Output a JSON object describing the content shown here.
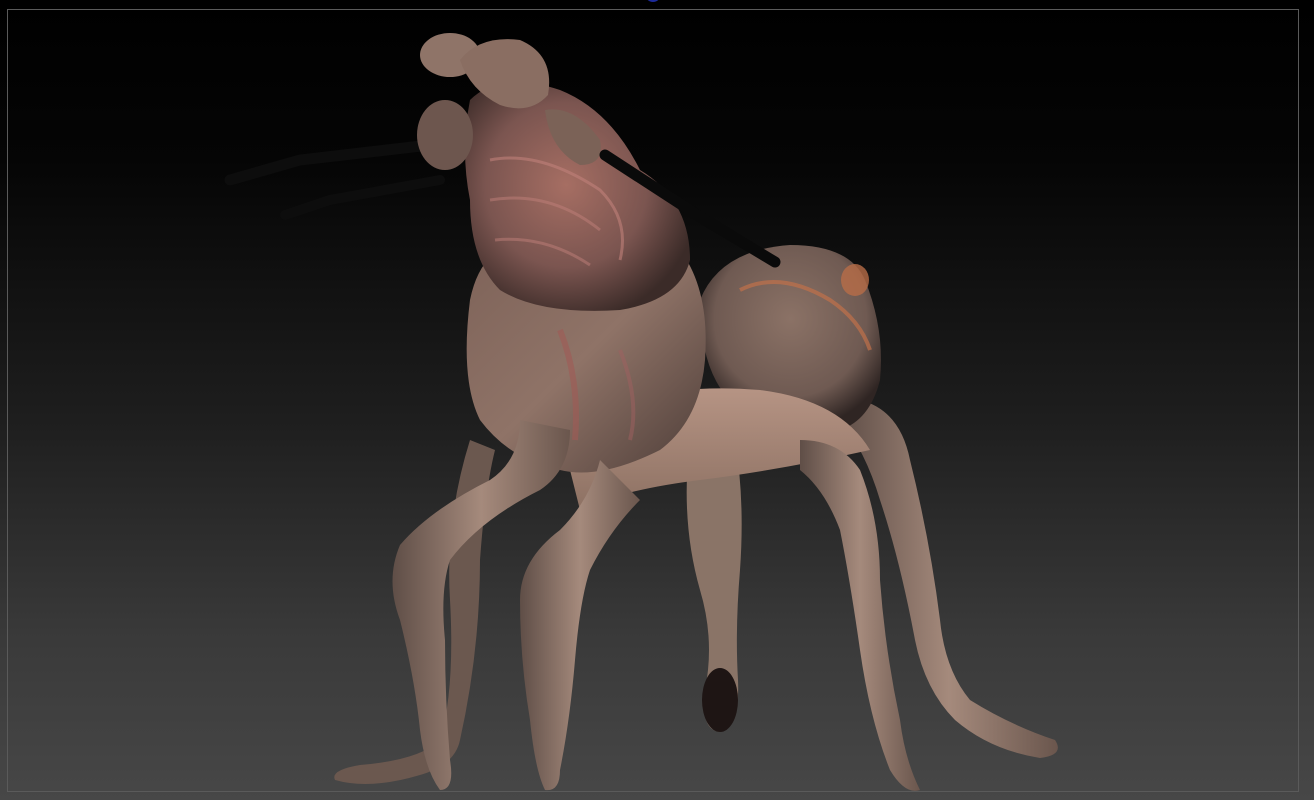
{
  "app": {
    "canvas_background": [
      "#000000",
      "#474747"
    ],
    "frame_color": "#5a5a5a"
  },
  "viewport": {
    "subject": "sculpted-creature-model",
    "skin_color": "#9a7d70",
    "flesh_color": "#8a5a55",
    "antenna_color": "#0a0a0a"
  },
  "gizmo": {
    "icon": "orientation-gizmo-icon",
    "color": "#1c2a9a"
  }
}
